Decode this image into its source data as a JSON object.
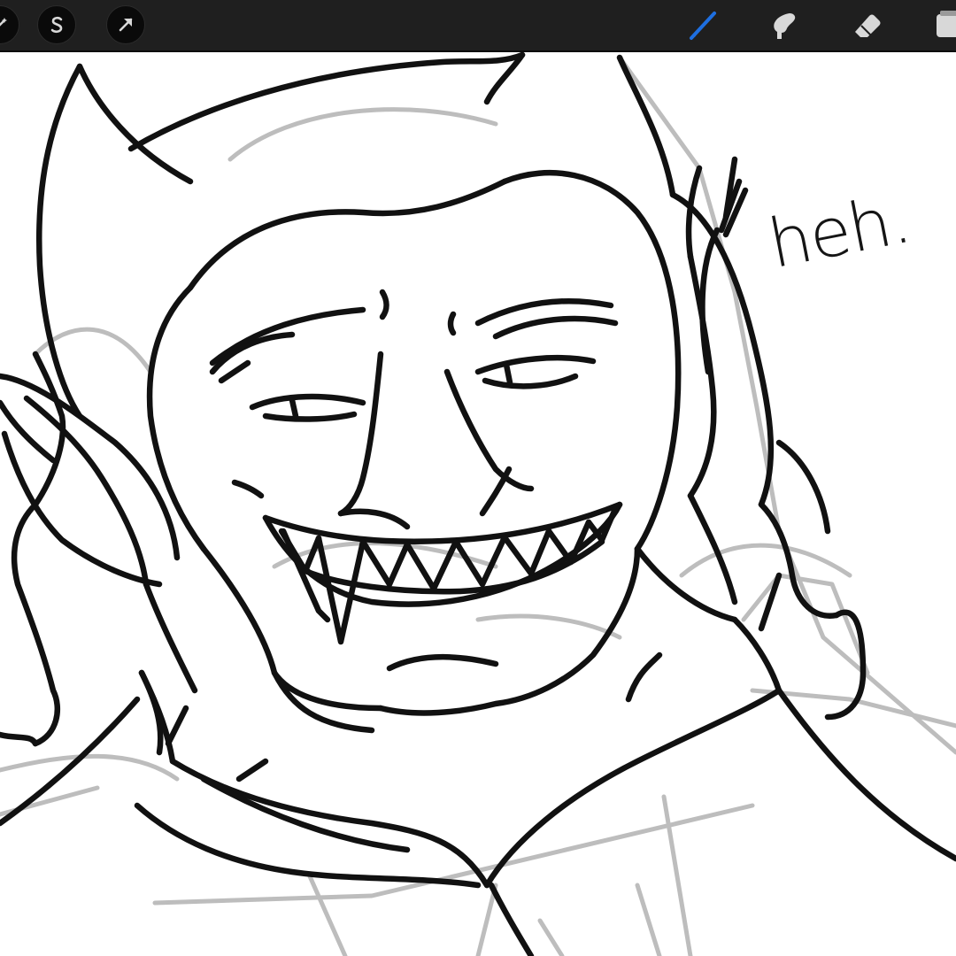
{
  "toolbar": {
    "left_tools": [
      {
        "name": "adjustments",
        "icon": "magic-wand-icon"
      },
      {
        "name": "selection",
        "icon": "selection-s-icon",
        "glyph": "S"
      },
      {
        "name": "transform",
        "icon": "arrow-cursor-icon"
      }
    ],
    "right_tools": [
      {
        "name": "brush",
        "icon": "brush-icon",
        "active": true
      },
      {
        "name": "smudge",
        "icon": "smudge-icon",
        "active": false
      },
      {
        "name": "eraser",
        "icon": "eraser-icon",
        "active": false
      },
      {
        "name": "layers",
        "icon": "layers-icon",
        "active": false
      }
    ]
  },
  "colors": {
    "toolbar_bg": "#1f1f1f",
    "icon_default": "#d8d8d8",
    "icon_active": "#1e6fe0",
    "ink": "#111111",
    "sketch": "#bdbdbd",
    "paper": "#ffffff"
  },
  "canvas": {
    "caption": "heh."
  }
}
